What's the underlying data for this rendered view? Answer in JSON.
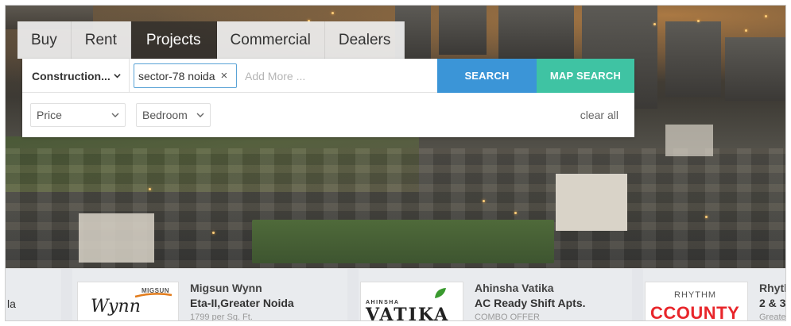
{
  "tabs": [
    {
      "label": "Buy",
      "active": false
    },
    {
      "label": "Rent",
      "active": false
    },
    {
      "label": "Projects",
      "active": true
    },
    {
      "label": "Commercial",
      "active": false
    },
    {
      "label": "Dealers",
      "active": false
    }
  ],
  "search": {
    "construction_filter": "Construction...",
    "location_chip": "sector-78 noida",
    "chip_remove": "×",
    "placeholder": "Add More ...",
    "search_button": "SEARCH",
    "map_search_button": "MAP SEARCH"
  },
  "filters": {
    "price": "Price",
    "bedroom": "Bedroom",
    "clear_all": "clear all"
  },
  "cards": {
    "partial_left": "la",
    "items": [
      {
        "logo_text": "Wynn",
        "logo_brand": "MIGSUN",
        "title": "Migsun Wynn",
        "subtitle": "Eta-II,Greater Noida",
        "detail": "1799 per Sq. Ft."
      },
      {
        "logo_text": "VATIKA",
        "logo_brand": "AHINSHA",
        "title": "Ahinsha Vatika",
        "subtitle": "AC Ready Shift Apts.",
        "detail": "COMBO OFFER"
      },
      {
        "logo_text": "CCOUNTY",
        "logo_brand": "RHYTHM",
        "title": "Rhytl",
        "subtitle": "2 & 3",
        "detail": "Greate"
      }
    ]
  },
  "colors": {
    "search_button": "#3b95d7",
    "map_search_button": "#3fc3a3",
    "active_tab": "#2f2f2f",
    "chip_border": "#5aa3d6",
    "county_red": "#e8262b"
  },
  "icons": {
    "dropdown": "chevron-down-icon",
    "remove": "close-icon"
  }
}
